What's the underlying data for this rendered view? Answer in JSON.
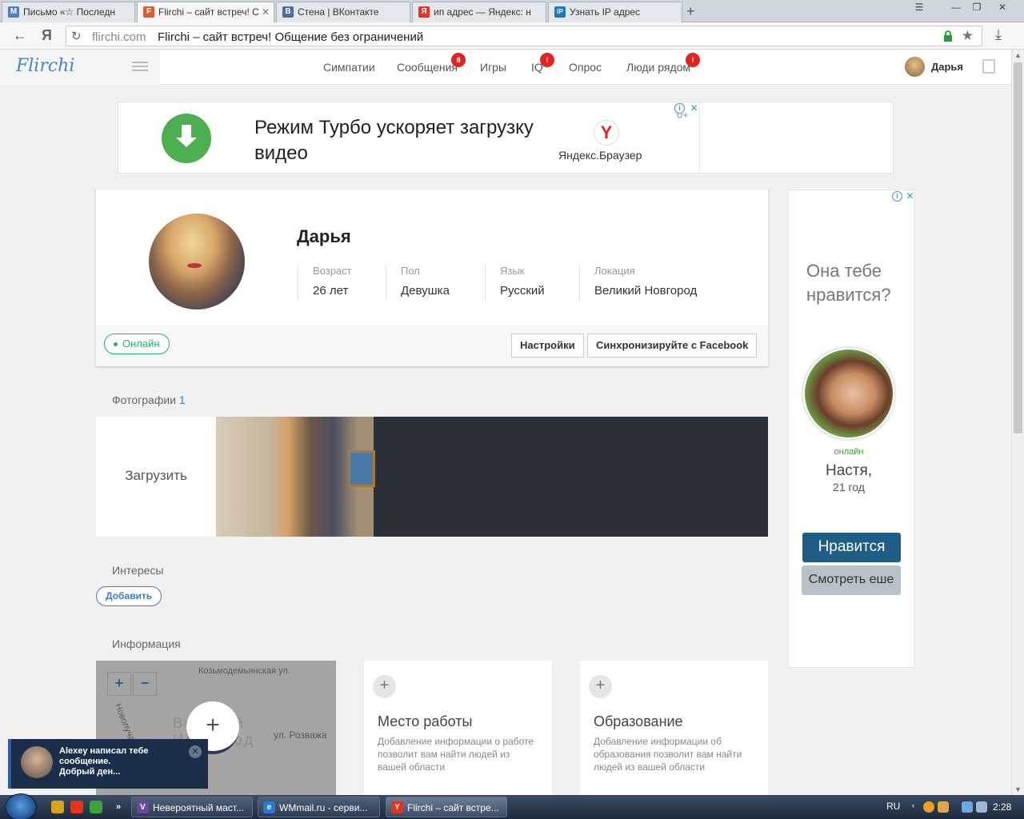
{
  "browser": {
    "tabs": [
      {
        "label": "Письмо «☆ Последн",
        "favicon": "M",
        "color": "#4a7fc1"
      },
      {
        "label": "Flirchi – сайт встреч! С",
        "favicon": "F",
        "color": "#e05a2a"
      },
      {
        "label": "Стена | ВКонтакте",
        "favicon": "B",
        "color": "#4a6f9c"
      },
      {
        "label": "ип адрес — Яндекс: н",
        "favicon": "Я",
        "color": "#e5331f"
      },
      {
        "label": "Узнать IP адрес",
        "favicon": "IP",
        "color": "#1f7aba"
      }
    ],
    "new_tab": "+",
    "yandex_glyph": "Я",
    "url_domain": "flirchi.com",
    "url_title": "Flirchi – сайт встреч! Общение без ограничений"
  },
  "site": {
    "logo": "Flirchi",
    "nav": [
      {
        "label": "Симпатии"
      },
      {
        "label": "Сообщения",
        "badge": "8"
      },
      {
        "label": "Игры"
      },
      {
        "label": "IQ",
        "badge": "!"
      },
      {
        "label": "Опрос"
      },
      {
        "label": "Люди рядом",
        "badge": "!"
      }
    ],
    "user_name": "Дарья"
  },
  "top_ad": {
    "text": "Режим Турбо ускоряет загрузку видео",
    "brand": "Яндекс.Браузер",
    "age": "0+",
    "logo": "Y",
    "info": "i",
    "close": "✕"
  },
  "profile": {
    "name": "Дарья",
    "stats": [
      {
        "label": "Возраст",
        "value": "26 лет"
      },
      {
        "label": "Пол",
        "value": "Девушка"
      },
      {
        "label": "Язык",
        "value": "Русский"
      },
      {
        "label": "Локация",
        "value": "Великий Новгород"
      }
    ],
    "online": "Онлайн",
    "settings_btn": "Настройки",
    "facebook_btn": "Синхронизируйте с Facebook"
  },
  "photos": {
    "title": "Фотографии",
    "count": "1",
    "upload": "Загрузить"
  },
  "interests": {
    "title": "Интересы",
    "add": "Добавить"
  },
  "info": {
    "title": "Информация",
    "map": {
      "streets": [
        "Козьмодемьянская ул.",
        "Новолучанская",
        "ул. Розважа",
        "Великий Новгород"
      ],
      "zoom_in": "+",
      "zoom_out": "−",
      "add": "+"
    },
    "cards": [
      {
        "title": "Место работы",
        "desc": "Добавление информации о работе позволит вам найти людей из вашей области"
      },
      {
        "title": "Образование",
        "desc": "Добавление информации об образования позволит вам найти людей из вашей области"
      }
    ],
    "plus": "+"
  },
  "side_ad": {
    "question": "Она тебе нравится?",
    "online": "онлайн",
    "name": "Настя,",
    "age": "21 год",
    "like": "Нравится",
    "more": "Смотреть еше"
  },
  "notification": {
    "text_line1": "Alexey написал тебе сообщение.",
    "text_line2": "Добрый ден...",
    "close": "✕"
  },
  "taskbar": {
    "tasks": [
      {
        "label": "Невероятный маст...",
        "icon": "V",
        "color": "#6a4a9e"
      },
      {
        "label": "WMmail.ru - серви...",
        "icon": "e",
        "color": "#2a7ad2"
      },
      {
        "label": "Flirchi – сайт встре...",
        "icon": "Y",
        "color": "#e5331f"
      }
    ],
    "lang": "RU",
    "clock": "2:28"
  }
}
